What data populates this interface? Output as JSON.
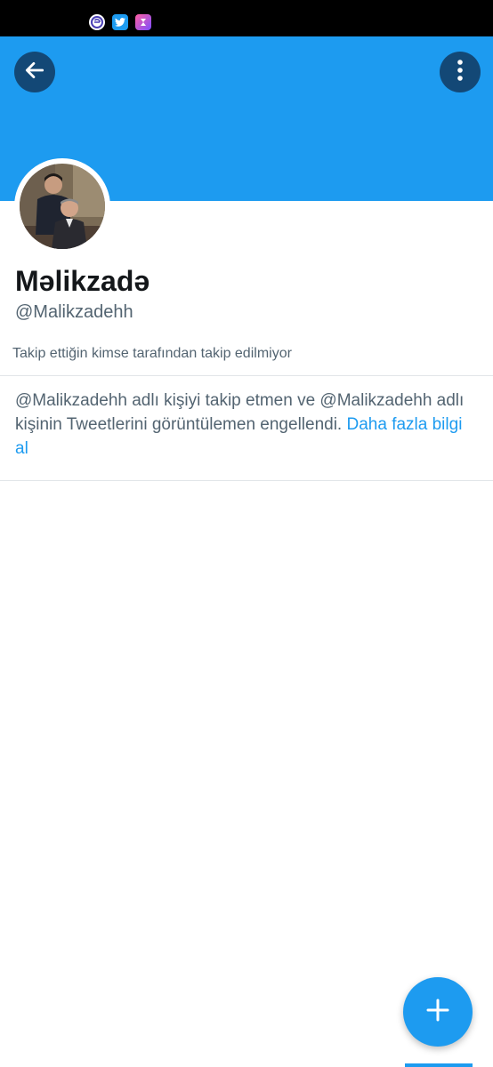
{
  "status_bar": {
    "icons": [
      "e-app-icon",
      "twitter-icon",
      "shortcut-app-icon"
    ],
    "background": "#000000"
  },
  "header": {
    "banner_color": "#1d9bf0",
    "back_icon": "arrow-left-icon",
    "more_icon": "more-vertical-icon"
  },
  "profile": {
    "display_name": "Məlikzadə",
    "handle": "@Malikzadehh",
    "follow_note": "Takip ettiğin kimse tarafından takip edilmiyor"
  },
  "blocked_notice": {
    "message": "@Malikzadehh adlı kişiyi takip etmen ve @Malikzadehh adlı kişinin Tweetlerini görüntülemen engellendi.",
    "link": "Daha fazla bilgi al",
    "link_color": "#1d9bf0"
  },
  "fab": {
    "icon": "plus-icon",
    "color": "#1d9bf0"
  }
}
